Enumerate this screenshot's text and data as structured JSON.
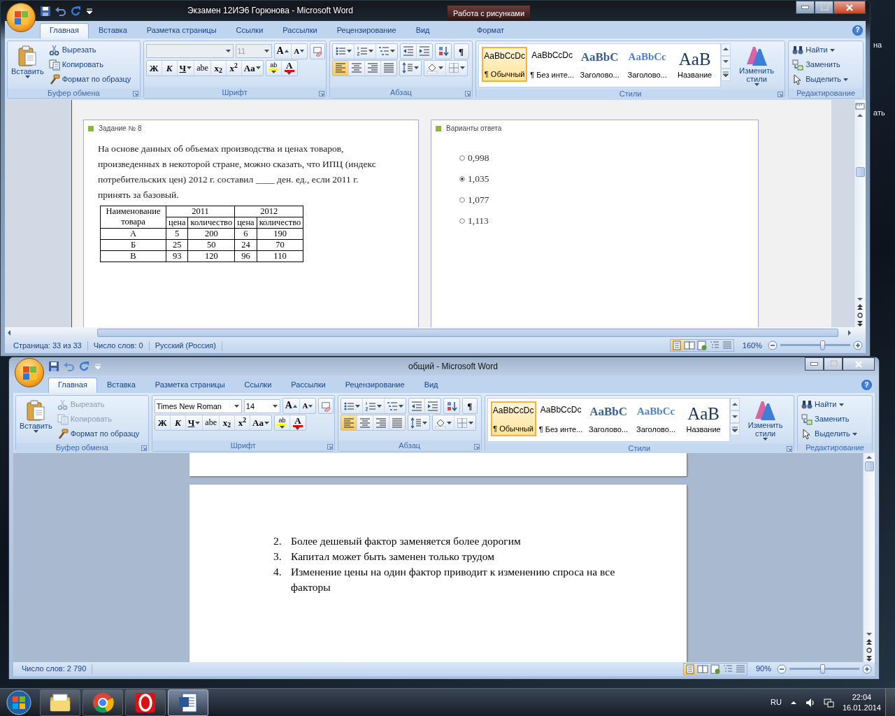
{
  "desktop_fragments": [
    "на",
    "ать"
  ],
  "windows": [
    {
      "title": "Экзамен 12ИЭ6 Горюнова - Microsoft Word",
      "context_group": "Работа с рисунками",
      "help": "?",
      "tabs": [
        {
          "label": "Главная",
          "selected": true
        },
        {
          "label": "Вставка",
          "selected": false
        },
        {
          "label": "Разметка страницы",
          "selected": false
        },
        {
          "label": "Ссылки",
          "selected": false
        },
        {
          "label": "Рассылки",
          "selected": false
        },
        {
          "label": "Рецензирование",
          "selected": false
        },
        {
          "label": "Вид",
          "selected": false
        },
        {
          "label": "Формат",
          "selected": false,
          "kind": "contextual"
        }
      ],
      "ribbon": {
        "clipboard": {
          "label": "Буфер обмена",
          "paste": "Вставить",
          "items": [
            {
              "kind": "cut",
              "label": "Вырезать",
              "disabled": false
            },
            {
              "kind": "copy",
              "label": "Копировать",
              "disabled": false
            },
            {
              "kind": "painter",
              "label": "Формат по образцу",
              "disabled": false
            }
          ]
        },
        "font": {
          "label": "Шрифт",
          "font_size": "11",
          "fields_disabled": true,
          "buttons": [
            {
              "kind": "grow",
              "label": "A"
            },
            {
              "kind": "shrink",
              "label": "A"
            },
            {
              "kind": "clear"
            },
            {
              "kind": "bold",
              "label": "Ж"
            },
            {
              "kind": "italic",
              "label": "К"
            },
            {
              "kind": "underline",
              "label": "Ч"
            },
            {
              "kind": "strike",
              "label": "abe"
            },
            {
              "kind": "sub",
              "label": "x$_{2}$"
            },
            {
              "kind": "sup",
              "label": "x$^{2}$"
            },
            {
              "kind": "case",
              "label": "Aa"
            },
            {
              "kind": "highlight",
              "label": "ab"
            },
            {
              "kind": "color",
              "label": "A"
            }
          ]
        },
        "paragraph": {
          "label": "Абзац",
          "show_marks": "¶",
          "alignments": [
            {
              "kind": "left",
              "selected": true
            },
            {
              "kind": "center",
              "selected": false
            },
            {
              "kind": "right",
              "selected": false
            },
            {
              "kind": "justify",
              "selected": false
            }
          ]
        },
        "styles": {
          "label": "Стили",
          "change": "Изменить стили",
          "items": [
            {
              "kind": "normal",
              "preview": "AaBbCcDc",
              "name": "¶ Обычный",
              "selected": true
            },
            {
              "kind": "no-spacing",
              "preview": "AaBbCcDc",
              "name": "¶ Без инте...",
              "selected": false
            },
            {
              "kind": "heading1",
              "preview": "AaBbC",
              "name": "Заголово...",
              "selected": false
            },
            {
              "kind": "heading2",
              "preview": "AaBbCc",
              "name": "Заголово...",
              "selected": false
            },
            {
              "kind": "title",
              "preview": "AaB",
              "name": "Название",
              "selected": false
            }
          ]
        },
        "editing": {
          "label": "Редактирование",
          "items": [
            {
              "kind": "find",
              "label": "Найти",
              "dropdown": true
            },
            {
              "kind": "replace",
              "label": "Заменить",
              "dropdown": false
            },
            {
              "kind": "select",
              "label": "Выделить",
              "dropdown": true
            }
          ]
        }
      },
      "document": {
        "kind": "exam",
        "task": {
          "title": "Задание № 8",
          "text": "На основе данных об объемах производства и ценах товаров, произведенных в некоторой стране, можно сказать, что ИПЦ (индекс потребительских цен) 2012 г. составил ____ ден. ед., если 2011 г. принять за базовый.",
          "table": {
            "header": [
              "Наименование товара",
              "2011",
              "2012"
            ],
            "subheader": [
              "цена",
              "количество",
              "цена",
              "количество"
            ],
            "rows": [
              [
                "А",
                "5",
                "200",
                "6",
                "190"
              ],
              [
                "Б",
                "25",
                "50",
                "24",
                "70"
              ],
              [
                "В",
                "93",
                "120",
                "96",
                "110"
              ]
            ]
          }
        },
        "answers": {
          "title": "Варианты ответа",
          "options": [
            {
              "label": "0,998",
              "selected": false
            },
            {
              "label": "1,035",
              "selected": true
            },
            {
              "label": "1,077",
              "selected": false
            },
            {
              "label": "1,113",
              "selected": false
            }
          ]
        }
      },
      "status_bar": {
        "items": [
          "Страница: 33 из 33",
          "Число слов: 0",
          "Русский (Россия)"
        ],
        "views": [
          {
            "kind": "print",
            "selected": true
          },
          {
            "kind": "reading",
            "selected": false
          },
          {
            "kind": "web",
            "selected": false
          },
          {
            "kind": "outline",
            "selected": false
          },
          {
            "kind": "draft",
            "selected": false
          }
        ],
        "zoom": "160%",
        "level": 0.6
      }
    },
    {
      "title": "общий - Microsoft Word",
      "help": "?",
      "tabs": [
        {
          "label": "Главная",
          "selected": true
        },
        {
          "label": "Вставка",
          "selected": false
        },
        {
          "label": "Разметка страницы",
          "selected": false
        },
        {
          "label": "Ссылки",
          "selected": false
        },
        {
          "label": "Рассылки",
          "selected": false
        },
        {
          "label": "Рецензирование",
          "selected": false
        },
        {
          "label": "Вид",
          "selected": false
        }
      ],
      "ribbon": {
        "clipboard": {
          "label": "Буфер обмена",
          "paste": "Вставить",
          "items": [
            {
              "kind": "cut",
              "label": "Вырезать",
              "disabled": true
            },
            {
              "kind": "copy",
              "label": "Копировать",
              "disabled": true
            },
            {
              "kind": "painter",
              "label": "Формат по образцу",
              "disabled": false
            }
          ]
        },
        "font": {
          "label": "Шрифт",
          "font_name": "Times New Roman",
          "font_size": "14",
          "fields_disabled": false,
          "buttons": [
            {
              "kind": "grow",
              "label": "A"
            },
            {
              "kind": "shrink",
              "label": "A"
            },
            {
              "kind": "clear"
            },
            {
              "kind": "bold",
              "label": "Ж"
            },
            {
              "kind": "italic",
              "label": "К"
            },
            {
              "kind": "underline",
              "label": "Ч"
            },
            {
              "kind": "strike",
              "label": "abe"
            },
            {
              "kind": "sub",
              "label": "x$_{2}$"
            },
            {
              "kind": "sup",
              "label": "x$^{2}$"
            },
            {
              "kind": "case",
              "label": "Aa"
            },
            {
              "kind": "highlight",
              "label": "ab"
            },
            {
              "kind": "color",
              "label": "A"
            }
          ]
        },
        "paragraph": {
          "label": "Абзац",
          "show_marks": "¶",
          "alignments": [
            {
              "kind": "left",
              "selected": true
            },
            {
              "kind": "center",
              "selected": false
            },
            {
              "kind": "right",
              "selected": false
            },
            {
              "kind": "justify",
              "selected": false
            }
          ]
        },
        "styles": {
          "label": "Стили",
          "change": "Изменить стили",
          "items": [
            {
              "kind": "normal",
              "preview": "AaBbCcDc",
              "name": "¶ Обычный",
              "selected": true
            },
            {
              "kind": "no-spacing",
              "preview": "AaBbCcDc",
              "name": "¶ Без инте...",
              "selected": false
            },
            {
              "kind": "heading1",
              "preview": "AaBbC",
              "name": "Заголово...",
              "selected": false
            },
            {
              "kind": "heading2",
              "preview": "AaBbCc",
              "name": "Заголово...",
              "selected": false
            },
            {
              "kind": "title",
              "preview": "AaB",
              "name": "Название",
              "selected": false
            }
          ]
        },
        "editing": {
          "label": "Редактирование",
          "items": [
            {
              "kind": "find",
              "label": "Найти",
              "dropdown": true
            },
            {
              "kind": "replace",
              "label": "Заменить",
              "dropdown": false
            },
            {
              "kind": "select",
              "label": "Выделить",
              "dropdown": true
            }
          ]
        }
      },
      "document": {
        "kind": "list",
        "items": [
          {
            "number": "2.",
            "text": "Более дешевый фактор заменяется более дорогим"
          },
          {
            "number": "3.",
            "text": "Капитал может быть заменен только трудом"
          },
          {
            "number": "4.",
            "text": "Изменение цены на один фактор приводит к изменению спроса на все факторы"
          }
        ]
      },
      "status_bar": {
        "items": [
          "Число слов: 2 790"
        ],
        "views": [
          {
            "kind": "print",
            "selected": true
          },
          {
            "kind": "reading",
            "selected": false
          },
          {
            "kind": "web",
            "selected": false
          },
          {
            "kind": "outline",
            "selected": false
          },
          {
            "kind": "draft",
            "selected": false
          }
        ],
        "zoom": "90%",
        "level": 0.47
      }
    }
  ],
  "taskbar": {
    "apps": [
      {
        "kind": "explorer",
        "selected": false
      },
      {
        "kind": "chrome",
        "selected": false
      },
      {
        "kind": "opera",
        "selected": false
      },
      {
        "kind": "word",
        "selected": true
      }
    ],
    "language": "RU",
    "time": "22:04",
    "date": "16.01.2014"
  }
}
